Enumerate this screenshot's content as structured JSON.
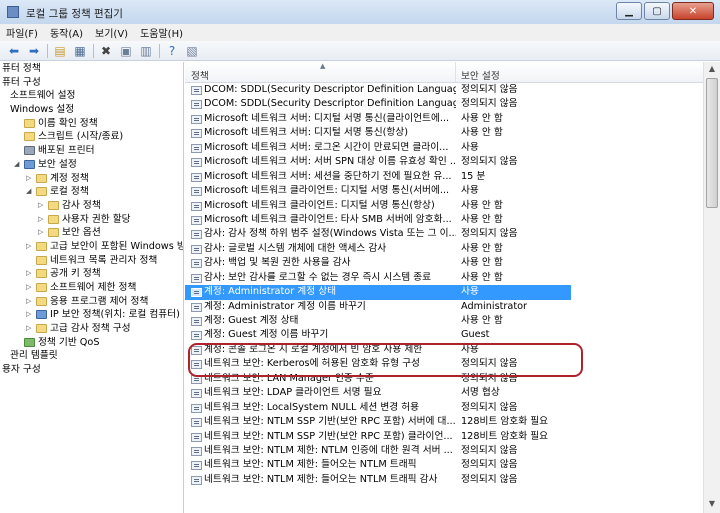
{
  "window": {
    "title": "로컬 그룹 정책 편집기"
  },
  "menu": [
    "파일(F)",
    "동작(A)",
    "보기(V)",
    "도움말(H)"
  ],
  "toolbar": [
    {
      "icon": "back-arrow-icon",
      "glyph": "⬅",
      "color": "#2d6fc0"
    },
    {
      "icon": "forward-arrow-icon",
      "glyph": "➡",
      "color": "#2d6fc0"
    },
    {
      "icon": "up-folder-icon",
      "glyph": "▤",
      "color": "#c99a2e"
    },
    {
      "icon": "show-hide-tree-icon",
      "glyph": "▦",
      "color": "#4b6a94"
    },
    {
      "icon": "delete-icon",
      "glyph": "✖",
      "color": "#444444"
    },
    {
      "icon": "properties-icon",
      "glyph": "▣",
      "color": "#6b7f99"
    },
    {
      "icon": "export-list-icon",
      "glyph": "▥",
      "color": "#6b7f99"
    },
    {
      "icon": "help-icon",
      "glyph": "?",
      "color": "#2d6fc0"
    },
    {
      "icon": "view-icon",
      "glyph": "▧",
      "color": "#6b7f99"
    }
  ],
  "tree": [
    {
      "label": "퓨터 정책",
      "indent": 0,
      "exp": "",
      "icon": ""
    },
    {
      "label": "퓨터 구성",
      "indent": 0,
      "exp": "",
      "icon": ""
    },
    {
      "label": "소프트웨어 설정",
      "indent": 1,
      "exp": "",
      "icon": ""
    },
    {
      "label": "Windows 설정",
      "indent": 1,
      "exp": "",
      "icon": ""
    },
    {
      "label": "이름 확인 정책",
      "indent": 2,
      "exp": "",
      "icon": "folder"
    },
    {
      "label": "스크립트 (시작/종료)",
      "indent": 2,
      "exp": "",
      "icon": "folder"
    },
    {
      "label": "배포된 프린터",
      "indent": 2,
      "exp": "",
      "icon": "printer"
    },
    {
      "label": "보안 설정",
      "indent": 2,
      "exp": "◢",
      "icon": "shield"
    },
    {
      "label": "계정 정책",
      "indent": 3,
      "exp": "▷",
      "icon": "folder"
    },
    {
      "label": "로컬 정책",
      "indent": 3,
      "exp": "◢",
      "icon": "folder"
    },
    {
      "label": "감사 정책",
      "indent": 4,
      "exp": "▷",
      "icon": "folder"
    },
    {
      "label": "사용자 권한 할당",
      "indent": 4,
      "exp": "▷",
      "icon": "folder"
    },
    {
      "label": "보안 옵션",
      "indent": 4,
      "exp": "▷",
      "icon": "folder"
    },
    {
      "label": "고급 보안이 포함된 Windows 방화",
      "indent": 3,
      "exp": "▷",
      "icon": "folder"
    },
    {
      "label": "네트워크 목록 관리자 정책",
      "indent": 3,
      "exp": "",
      "icon": "folder"
    },
    {
      "label": "공개 키 정책",
      "indent": 3,
      "exp": "▷",
      "icon": "folder"
    },
    {
      "label": "소프트웨어 제한 정책",
      "indent": 3,
      "exp": "▷",
      "icon": "folder"
    },
    {
      "label": "응용 프로그램 제어 정책",
      "indent": 3,
      "exp": "▷",
      "icon": "folder"
    },
    {
      "label": "IP 보안 정책(위치: 로컬 컴퓨터)",
      "indent": 3,
      "exp": "▷",
      "icon": "shield"
    },
    {
      "label": "고급 감사 정책 구성",
      "indent": 3,
      "exp": "▷",
      "icon": "folder"
    },
    {
      "label": "정책 기반 QoS",
      "indent": 2,
      "exp": "",
      "icon": "chart"
    },
    {
      "label": "관리 템플릿",
      "indent": 1,
      "exp": "",
      "icon": ""
    },
    {
      "label": "용자 구성",
      "indent": 0,
      "exp": "",
      "icon": ""
    }
  ],
  "columns": {
    "policy": "정책",
    "setting": "보안 설정"
  },
  "rows": [
    {
      "policy": "DCOM: SDDL(Security Descriptor Definition Language) 구...",
      "setting": "정의되지 않음"
    },
    {
      "policy": "DCOM: SDDL(Security Descriptor Definition Language) 구...",
      "setting": "정의되지 않음"
    },
    {
      "policy": "Microsoft 네트워크 서버: 디지털 서명 통신(클라이언트에...",
      "setting": "사용 안 함"
    },
    {
      "policy": "Microsoft 네트워크 서버: 디지털 서명 통신(항상)",
      "setting": "사용 안 함"
    },
    {
      "policy": "Microsoft 네트워크 서버: 로그온 시간이 만료되면 클라이...",
      "setting": "사용"
    },
    {
      "policy": "Microsoft 네트워크 서버: 서버 SPN 대상 이름 유효성 확인 ...",
      "setting": "정의되지 않음"
    },
    {
      "policy": "Microsoft 네트워크 서버: 세션을 중단하기 전에 필요한 유...",
      "setting": "15 분"
    },
    {
      "policy": "Microsoft 네트워크 클라이언트: 디지털 서명 통신(서버에...",
      "setting": "사용"
    },
    {
      "policy": "Microsoft 네트워크 클라이언트: 디지털 서명 통신(항상)",
      "setting": "사용 안 함"
    },
    {
      "policy": "Microsoft 네트워크 클라이언트: 타사 SMB 서버에 암호화...",
      "setting": "사용 안 함"
    },
    {
      "policy": "감사: 감사 정책 하위 범주 설정(Windows Vista 또는 그 이...",
      "setting": "정의되지 않음"
    },
    {
      "policy": "감사: 글로벌 시스템 개체에 대한 액세스 감사",
      "setting": "사용 안 함"
    },
    {
      "policy": "감사: 백업 및 복원 권한 사용을 감사",
      "setting": "사용 안 함"
    },
    {
      "policy": "감사: 보안 감사를 로그할 수 없는 경우 즉시 시스템 종료",
      "setting": "사용 안 함"
    },
    {
      "policy": "계정: Administrator 계정 상태",
      "setting": "사용",
      "selected": true
    },
    {
      "policy": "계정: Administrator 계정 이름 바꾸기",
      "setting": "Administrator"
    },
    {
      "policy": "계정: Guest 계정 상태",
      "setting": "사용 안 함"
    },
    {
      "policy": "계정: Guest 계정 이름 바꾸기",
      "setting": "Guest"
    },
    {
      "policy": "계정: 콘솔 로그온 시 로컬 계정에서 빈 암호 사용 제한",
      "setting": "사용"
    },
    {
      "policy": "네트워크 보안: Kerberos에 허용된 암호화 유형 구성",
      "setting": "정의되지 않음"
    },
    {
      "policy": "네트워크 보안: LAN Manager 인증 수준",
      "setting": "정의되지 않음"
    },
    {
      "policy": "네트워크 보안: LDAP 클라이언트 서명 필요",
      "setting": "서명 협상"
    },
    {
      "policy": "네트워크 보안: LocalSystem NULL 세션 변경 허용",
      "setting": "정의되지 않음"
    },
    {
      "policy": "네트워크 보안: NTLM SSP 기반(보안 RPC 포함) 서버에 대...",
      "setting": "128비트 암호화 필요"
    },
    {
      "policy": "네트워크 보안: NTLM SSP 기반(보안 RPC 포함) 클라이언...",
      "setting": "128비트 암호화 필요"
    },
    {
      "policy": "네트워크 보안: NTLM 제한: NTLM 인증에 대한 원격 서버 ...",
      "setting": "정의되지 않음"
    },
    {
      "policy": "네트워크 보안: NTLM 제한: 들어오는 NTLM 트래픽",
      "setting": "정의되지 않음"
    },
    {
      "policy": "네트워크 보안: NTLM 제한: 들어오는 NTLM 트래픽 감사",
      "setting": "정의되지 않음"
    }
  ]
}
